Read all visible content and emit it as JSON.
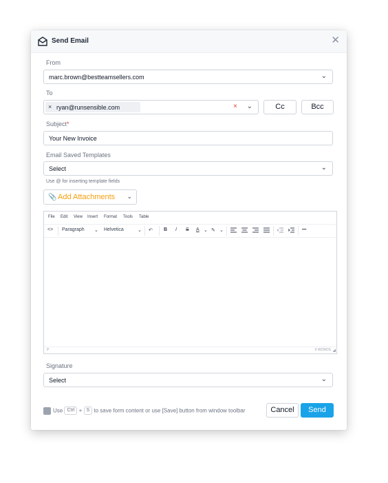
{
  "dialog": {
    "title": "Send Email",
    "close_icon": "close-icon",
    "envelope_icon": "envelope-open-icon"
  },
  "from": {
    "label": "From",
    "value": "marc.brown@bestteamsellers.com"
  },
  "to": {
    "label": "To",
    "recipients": [
      {
        "email": "ryan@runsensible.com"
      }
    ],
    "remove_glyph": "×",
    "clear_glyph": "×",
    "cc_label": "Cc",
    "bcc_label": "Bcc"
  },
  "subject": {
    "label": "Subject",
    "required_mark": "*",
    "value": "Your New Invoice"
  },
  "templates": {
    "label": "Email Saved Templates",
    "selected": "Select",
    "hint": "Use @ for inserting template fields"
  },
  "attachments": {
    "label": "Add Attachments",
    "icon": "paperclip-icon"
  },
  "editor": {
    "menu": [
      "File",
      "Edit",
      "View",
      "Insert",
      "Format",
      "Tools",
      "Table"
    ],
    "toolbar": {
      "source": "<>",
      "block_format": "Paragraph",
      "font_family": "Helvetica",
      "undo": "↶",
      "bold": "B",
      "italic": "I",
      "strikethrough": "S",
      "text_color": "A",
      "highlight": "✎",
      "more": "•••"
    },
    "status_path": "P",
    "word_count": "0 WORDS"
  },
  "signature": {
    "label": "Signature",
    "selected": "Select"
  },
  "footer": {
    "hint_use": "Use",
    "key_ctrl": "Ctrl",
    "plus": "+",
    "key_s": "S",
    "hint_rest": "to save form content or use [Save] button from window toolbar",
    "cancel_label": "Cancel",
    "send_label": "Send"
  },
  "colors": {
    "accent": "#1aa3e8",
    "attach": "#f59e0b",
    "required": "#e53935"
  }
}
